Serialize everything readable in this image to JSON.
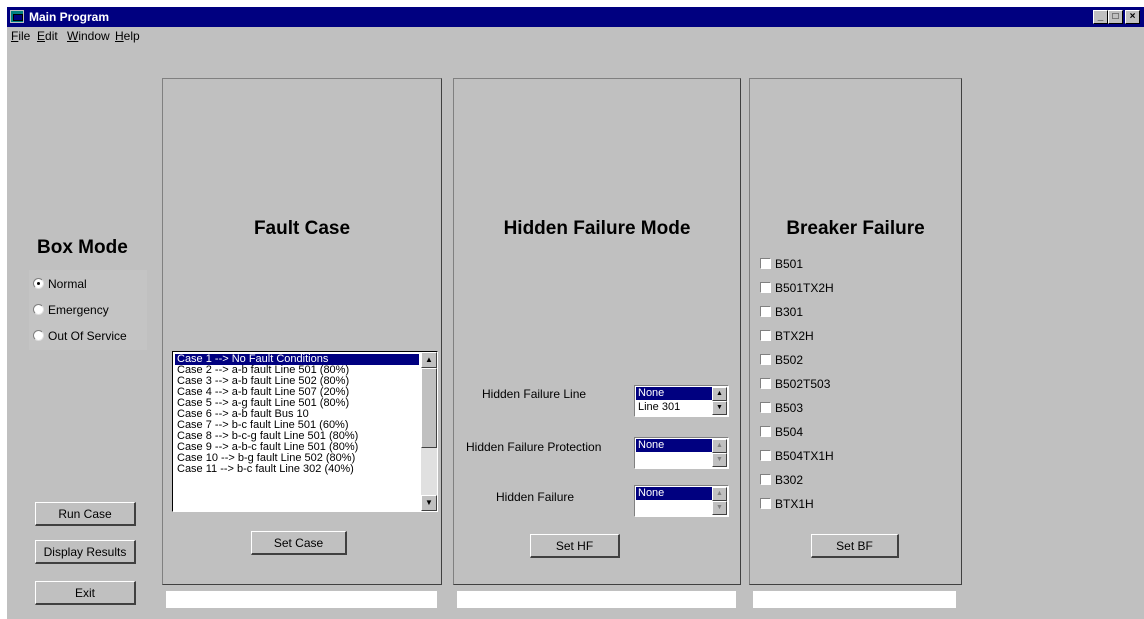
{
  "window": {
    "title": "Main Program",
    "controls": [
      "_",
      "□",
      "×"
    ]
  },
  "menu": [
    {
      "label": "File",
      "key": "F",
      "rest": "ile"
    },
    {
      "label": "Edit",
      "key": "E",
      "rest": "dit"
    },
    {
      "label": "Window",
      "key": "W",
      "rest": "indow"
    },
    {
      "label": "Help",
      "key": "H",
      "rest": "elp"
    }
  ],
  "box_mode": {
    "title": "Box Mode",
    "options": [
      {
        "label": "Normal",
        "selected": true
      },
      {
        "label": "Emergency",
        "selected": false
      },
      {
        "label": "Out Of Service",
        "selected": false
      }
    ]
  },
  "actions": {
    "run_case": "Run Case",
    "display_results": "Display Results",
    "exit": "Exit"
  },
  "fault_case": {
    "title": "Fault Case",
    "cases": [
      "Case 1 --> No Fault Conditions",
      "Case 2 --> a-b fault Line 501 (80%)",
      "Case 3 --> a-b fault Line 502 (80%)",
      "Case 4 --> a-b fault Line 507 (20%)",
      "Case 5 --> a-g fault Line 501 (80%)",
      "Case 6 --> a-b fault Bus 10",
      "Case 7 --> b-c fault Line 501 (60%)",
      "Case 8 --> b-c-g fault Line 501 (80%)",
      "Case 9 --> a-b-c fault Line 501 (80%)",
      "Case 10 --> b-g fault Line 502 (80%)",
      "Case 11 --> b-c fault Line 302 (40%)"
    ],
    "selected_index": 0,
    "set_button": "Set Case",
    "status": ""
  },
  "hidden_failure": {
    "title": "Hidden Failure Mode",
    "line": {
      "label": "Hidden Failure Line",
      "selected": "None",
      "next": "Line 301"
    },
    "protection": {
      "label": "Hidden Failure Protection",
      "selected": "None",
      "next": ""
    },
    "failure": {
      "label": "Hidden Failure",
      "selected": "None",
      "next": ""
    },
    "set_button": "Set HF",
    "status": ""
  },
  "breaker_failure": {
    "title": "Breaker Failure",
    "breakers": [
      "B501",
      "B501TX2H",
      "B301",
      "BTX2H",
      "B502",
      "B502T503",
      "B503",
      "B504",
      "B504TX1H",
      "B302",
      "BTX1H"
    ],
    "set_button": "Set BF",
    "status": ""
  }
}
